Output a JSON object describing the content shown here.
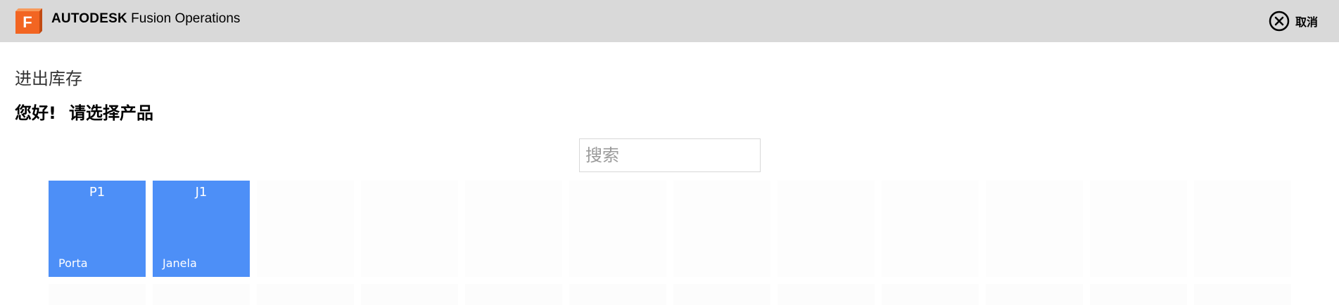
{
  "header": {
    "brand_strong": "AUTODESK",
    "brand_light": "Fusion Operations",
    "logo_letter": "F",
    "logo_icon": "autodesk-fusion-logo",
    "cancel_label": "取消",
    "cancel_icon": "close-circle-icon"
  },
  "page": {
    "section_title": "进出库存",
    "greeting_hello": "您好!",
    "greeting_prompt": "请选择产品"
  },
  "search": {
    "placeholder": "搜索",
    "value": ""
  },
  "products": [
    {
      "code": "P1",
      "name": "Porta"
    },
    {
      "code": "J1",
      "name": "Janela"
    }
  ],
  "colors": {
    "header_bg": "#d9d9d9",
    "tile_blue": "#4d8ff7",
    "logo_orange": "#f26522"
  }
}
